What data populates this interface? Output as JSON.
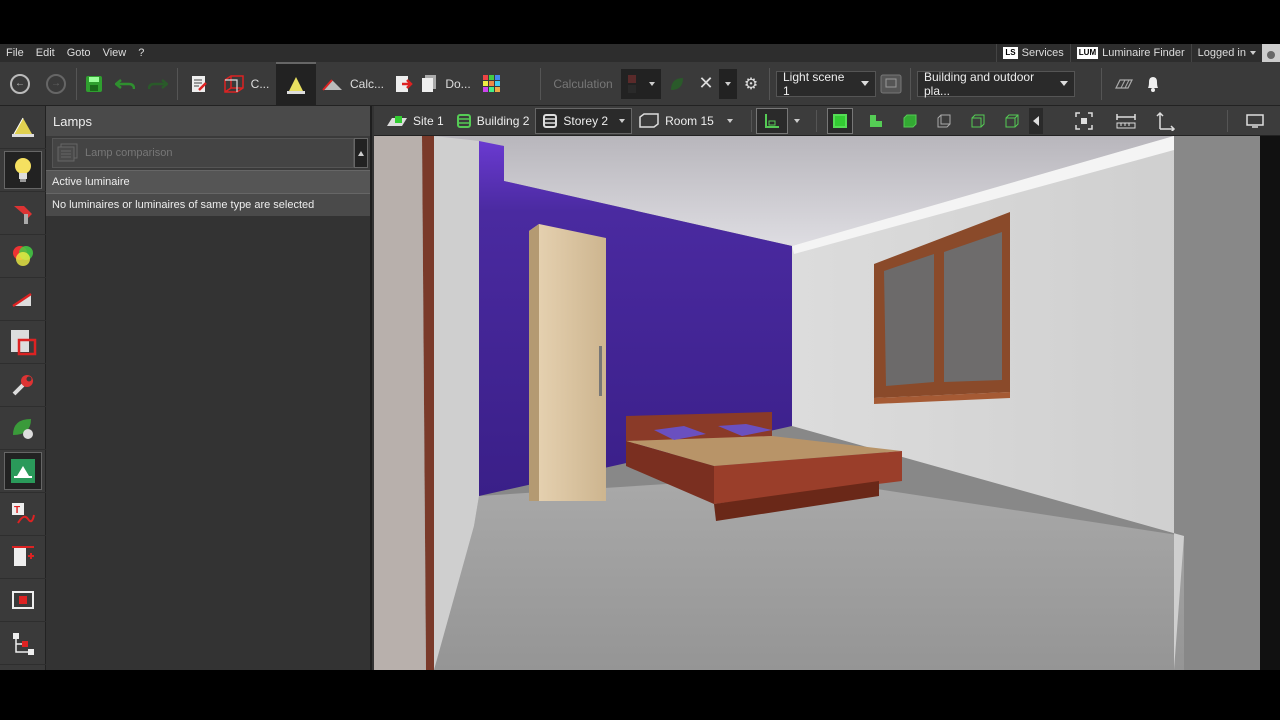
{
  "menu": [
    "File",
    "Edit",
    "Goto",
    "View",
    "?"
  ],
  "topright": {
    "services_badge": "LS",
    "services": "Services",
    "finder_badge": "LUM",
    "finder": "Luminaire Finder",
    "login": "Logged in"
  },
  "toolbar": {
    "c_label": "C...",
    "calc_label": "Calc...",
    "do_label": "Do...",
    "calculation": "Calculation",
    "light_scene": "Light scene 1",
    "building_filter": "Building and outdoor pla..."
  },
  "nav": {
    "site": "Site 1",
    "building": "Building 2",
    "storey": "Storey 2",
    "room": "Room 15"
  },
  "panel": {
    "title": "Lamps",
    "lamp_comparison": "Lamp comparison",
    "active_luminaire": "Active luminaire",
    "no_selection": "No luminaires or luminaires of same type are selected"
  },
  "sidebar_icons": [
    "lamp-icon",
    "bulb-icon",
    "tools-icon",
    "color-wheel-icon",
    "angle-icon",
    "cut-icon",
    "wrench-icon",
    "leaf-icon",
    "emergency-exit-icon",
    "text-curve-icon",
    "door-icon",
    "frame-icon",
    "tree-icon"
  ],
  "colors": {
    "accent_green": "#33cc33",
    "wall_purple": "#4a2aa0",
    "panel_bg": "#333333"
  }
}
